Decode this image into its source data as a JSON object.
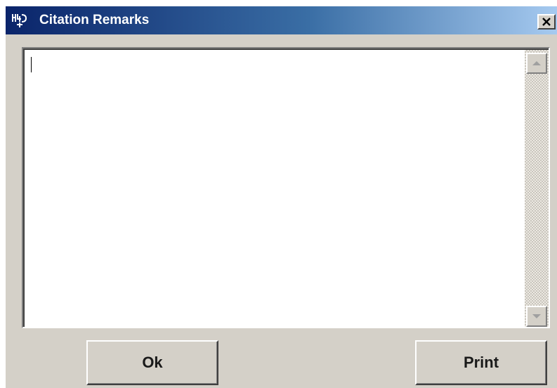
{
  "window": {
    "title": "Citation Remarks",
    "app_icon": "app-logo-icon",
    "close_icon": "close-icon"
  },
  "remarks": {
    "value": "",
    "placeholder": ""
  },
  "scrollbar": {
    "up_icon": "arrow-up-icon",
    "down_icon": "arrow-down-icon"
  },
  "buttons": {
    "ok_label": "Ok",
    "print_label": "Print"
  },
  "colors": {
    "titlebar_start": "#0a246a",
    "titlebar_end": "#a6caf0",
    "window_face": "#d4d0c8"
  }
}
